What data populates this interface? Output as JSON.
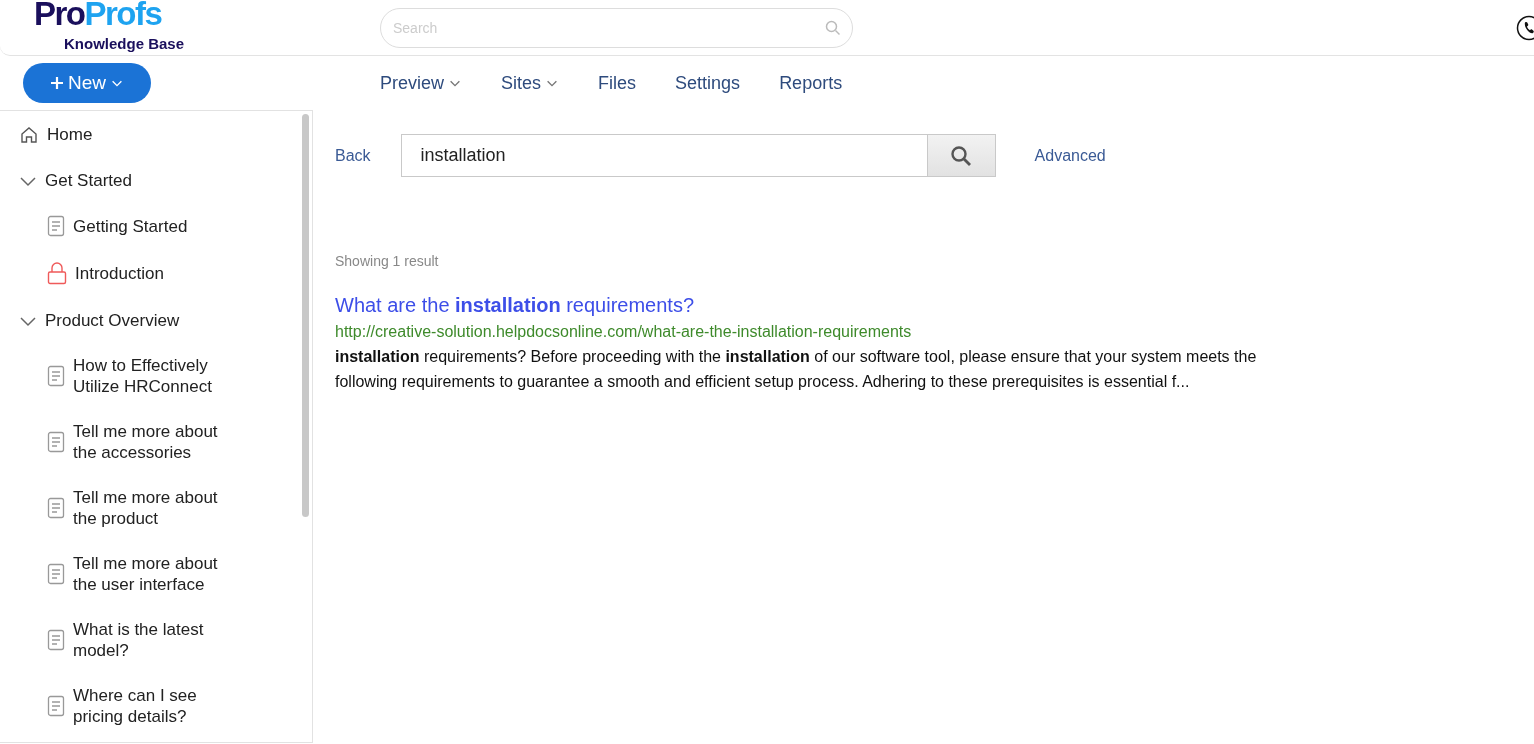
{
  "header": {
    "logo": {
      "wordmark_parts": [
        "Pro",
        "Profs"
      ],
      "subtitle": "Knowledge Base"
    },
    "search": {
      "placeholder": "Search"
    }
  },
  "new_button": {
    "label": "New"
  },
  "nav": [
    {
      "label": "Preview",
      "dropdown": true
    },
    {
      "label": "Sites",
      "dropdown": true
    },
    {
      "label": "Files",
      "dropdown": false
    },
    {
      "label": "Settings",
      "dropdown": false
    },
    {
      "label": "Reports",
      "dropdown": false
    }
  ],
  "sidebar": {
    "items": [
      {
        "label": "Home",
        "kind": "home"
      },
      {
        "label": "Get Started",
        "kind": "category",
        "expanded": true,
        "children": [
          {
            "label": "Getting Started",
            "kind": "article"
          },
          {
            "label": "Introduction",
            "kind": "locked"
          }
        ]
      },
      {
        "label": "Product Overview",
        "kind": "category",
        "expanded": true,
        "children": [
          {
            "label": "How to Effectively Utilize HRConnect",
            "kind": "article"
          },
          {
            "label": "Tell me more about the accessories",
            "kind": "article"
          },
          {
            "label": "Tell me more about the product",
            "kind": "article"
          },
          {
            "label": "Tell me more about the user interface",
            "kind": "article"
          },
          {
            "label": "What is the latest model?",
            "kind": "article"
          },
          {
            "label": "Where can I see pricing details?",
            "kind": "article"
          }
        ]
      }
    ]
  },
  "search_page": {
    "back": "Back",
    "query": "installation",
    "advanced": "Advanced",
    "result_count": "Showing 1 result",
    "results": [
      {
        "title": "What are the **installation** requirements?",
        "url": "http://creative-solution.helpdocsonline.com/what-are-the-installation-requirements",
        "snippet": "**installation** requirements? Before proceeding with the **installation** of our software tool, please ensure that your system meets the following requirements to guarantee a smooth and efficient setup process. Adhering to these prerequisites is essential f..."
      }
    ]
  }
}
